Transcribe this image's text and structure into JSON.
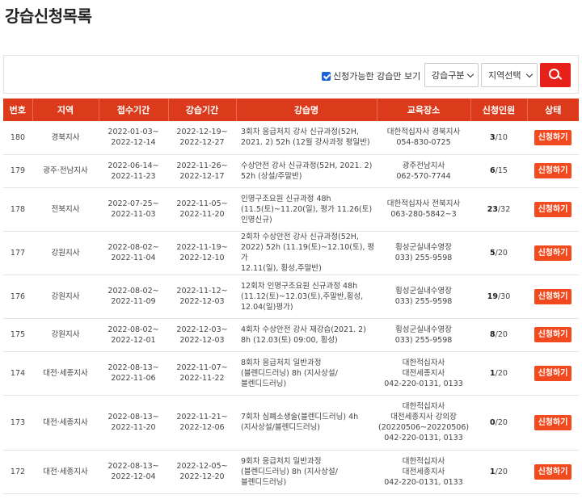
{
  "page": {
    "title": "강습신청목록"
  },
  "filters": {
    "checkbox_label": "신청가능한 강습만 보기",
    "checkbox_checked": true,
    "type_select": "강습구분",
    "region_select": "지역선택",
    "search_icon": "search-icon"
  },
  "table": {
    "headers": [
      "번호",
      "지역",
      "접수기간",
      "강습기간",
      "강습명",
      "교육장소",
      "신청인원",
      "상태"
    ],
    "rows": [
      {
        "no": "180",
        "region": "경북지사",
        "reg": [
          "2022-01-03~",
          "2022-12-14"
        ],
        "period": [
          "2022-12-19~",
          "2022-12-27"
        ],
        "course": [
          "3회차 응급처치 강사 신규과정(52H,",
          "2021. 2) 52h (12월 강사과정 평일반)"
        ],
        "place": [
          "대한적십자사 경북지사",
          "054-830-0725"
        ],
        "cur": "3",
        "max": "/10",
        "status": "신청하기"
      },
      {
        "no": "179",
        "region": "광주·전남지사",
        "reg": [
          "2022-06-14~",
          "2022-11-23"
        ],
        "period": [
          "2022-11-26~",
          "2022-12-17"
        ],
        "course": [
          "수상안전 강사 신규과정(52H, 2021. 2)",
          "52h (상설/주말반)"
        ],
        "place": [
          "광주전남지사",
          "062-570-7744"
        ],
        "cur": "6",
        "max": "/15",
        "status": "신청하기"
      },
      {
        "no": "178",
        "region": "전북지사",
        "reg": [
          "2022-07-25~",
          "2022-11-03"
        ],
        "period": [
          "2022-11-05~",
          "2022-11-20"
        ],
        "course": [
          "인명구조요원 신규과정 48h",
          "(11.5(토)~11.20(일), 평가 11.26(토)",
          "인명신규)"
        ],
        "place": [
          "대한적십자사 전북지사",
          "063-280-5842~3"
        ],
        "cur": "23",
        "max": "/32",
        "status": "신청하기"
      },
      {
        "no": "177",
        "region": "강원지사",
        "reg": [
          "2022-08-02~",
          "2022-11-04"
        ],
        "period": [
          "2022-11-19~",
          "2022-12-10"
        ],
        "course": [
          "2회차 수상안전 강사 신규과정(52H,",
          "2022) 52h (11.19(토)~12.10(토), 평가",
          "12.11(일), 횡성,주말반)"
        ],
        "place": [
          "횡성군실내수영장",
          "033) 255-9598"
        ],
        "cur": "5",
        "max": "/20",
        "status": "신청하기"
      },
      {
        "no": "176",
        "region": "강원지사",
        "reg": [
          "2022-08-02~",
          "2022-11-09"
        ],
        "period": [
          "2022-11-12~",
          "2022-12-03"
        ],
        "course": [
          "12회차 인명구조요원 신규과정 48h",
          "(11.12(토)~12.03(토),주말반,횡성,",
          "12.04(일)평가)"
        ],
        "place": [
          "횡성군실내수영장",
          "033) 255-9598"
        ],
        "cur": "19",
        "max": "/30",
        "status": "신청하기"
      },
      {
        "no": "175",
        "region": "강원지사",
        "reg": [
          "2022-08-02~",
          "2022-12-01"
        ],
        "period": [
          "2022-12-03~",
          "2022-12-03"
        ],
        "course": [
          "4회차 수상안전 강사 재강습(2021. 2)",
          "8h (12.03(토) 09:00, 횡성)"
        ],
        "place": [
          "횡성군실내수영장",
          "033) 255-9598"
        ],
        "cur": "8",
        "max": "/20",
        "status": "신청하기"
      },
      {
        "no": "174",
        "region": "대전·세종지사",
        "reg": [
          "2022-08-13~",
          "2022-11-06"
        ],
        "period": [
          "2022-11-07~",
          "2022-11-22"
        ],
        "course": [
          "8회차 응급처치 일반과정",
          "(블렌디드러닝) 8h (지사상설/",
          "블렌디드러닝)"
        ],
        "place": [
          "대한적십자사",
          "대전세종지사",
          "042-220-0131, 0133"
        ],
        "cur": "1",
        "max": "/20",
        "status": "신청하기"
      },
      {
        "no": "173",
        "region": "대전·세종지사",
        "reg": [
          "2022-08-13~",
          "2022-11-20"
        ],
        "period": [
          "2022-11-21~",
          "2022-12-06"
        ],
        "course": [
          "7회차 심폐소생술(블렌디드러닝) 4h",
          "(지사상설/블렌디드러닝)"
        ],
        "place": [
          "대한적십자사",
          "대전세종지사 강의장",
          "(20220506~20220506)",
          "042-220-0131, 0133"
        ],
        "cur": "0",
        "max": "/20",
        "status": "신청하기"
      },
      {
        "no": "172",
        "region": "대전·세종지사",
        "reg": [
          "2022-08-13~",
          "2022-12-04"
        ],
        "period": [
          "2022-12-05~",
          "2022-12-20"
        ],
        "course": [
          "9회차 응급처치 일반과정",
          "(블렌디드러닝) 8h (지사상설/",
          "블렌디드러닝)"
        ],
        "place": [
          "대한적십자사",
          "대전세종지사",
          "042-220-0131, 0133"
        ],
        "cur": "1",
        "max": "/20",
        "status": "신청하기"
      }
    ]
  },
  "colors": {
    "header_bg": "#db3a1b",
    "apply_btn": "#f14a1e",
    "search_btn": "#e8201a"
  }
}
